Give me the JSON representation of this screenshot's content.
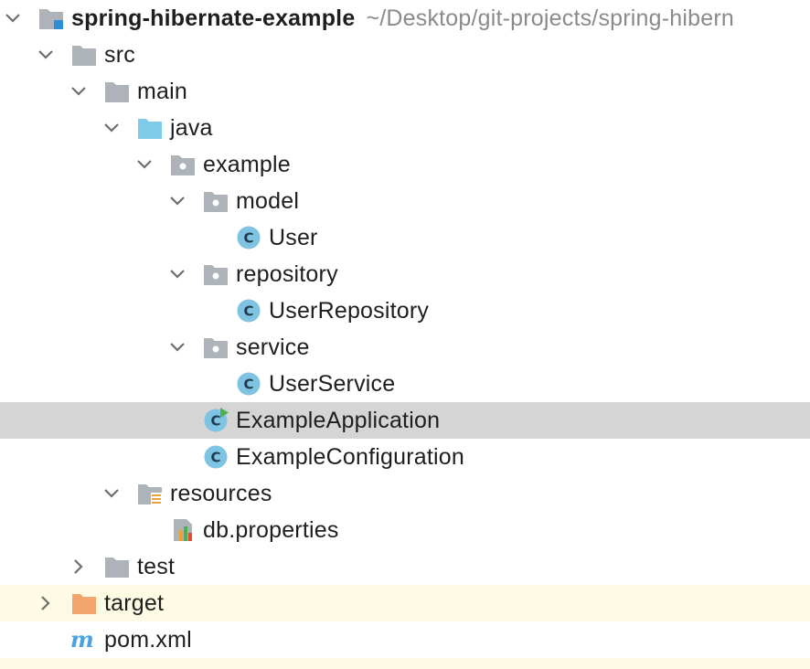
{
  "project": {
    "name": "spring-hibernate-example",
    "path": "~/Desktop/git-projects/spring-hibern"
  },
  "nodes": {
    "src": "src",
    "main": "main",
    "java": "java",
    "example": "example",
    "model": "model",
    "user": "User",
    "repository": "repository",
    "user_repository": "UserRepository",
    "service": "service",
    "user_service": "UserService",
    "example_application": "ExampleApplication",
    "example_configuration": "ExampleConfiguration",
    "resources": "resources",
    "db_properties": "db.properties",
    "test": "test",
    "target": "target",
    "pom": "pom.xml"
  },
  "colors": {
    "selected_row": "#d5d5d5",
    "excluded_row": "#fdfbe3",
    "folder": "#aeb3b9",
    "source_folder": "#7ecbea",
    "excluded_folder": "#f4a56e",
    "class_icon": "#7fc3e2",
    "run_badge": "#4caf50",
    "maven": "#4aa3e0"
  }
}
